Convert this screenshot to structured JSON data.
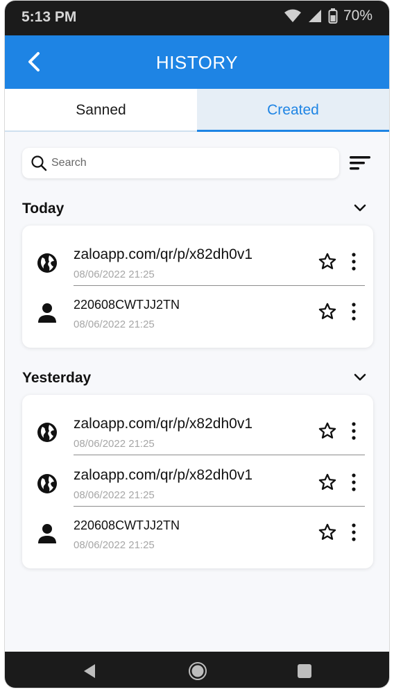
{
  "status": {
    "time": "5:13 PM",
    "battery": "70%"
  },
  "header": {
    "title": "HISTORY"
  },
  "tabs": [
    {
      "label": "Sanned"
    },
    {
      "label": "Created"
    }
  ],
  "search": {
    "placeholder": "Search"
  },
  "sections": [
    {
      "title": "Today",
      "items": [
        {
          "type": "globe-icon",
          "text": "zaloapp.com/qr/p/x82dh0v1",
          "date": "08/06/2022   21:25"
        },
        {
          "type": "person-icon",
          "text": "220608CWTJJ2TN",
          "date": "08/06/2022   21:25"
        }
      ]
    },
    {
      "title": "Yesterday",
      "items": [
        {
          "type": "globe-icon",
          "text": "zaloapp.com/qr/p/x82dh0v1",
          "date": "08/06/2022   21:25"
        },
        {
          "type": "globe-icon",
          "text": "zaloapp.com/qr/p/x82dh0v1",
          "date": "08/06/2022   21:25"
        },
        {
          "type": "person-icon",
          "text": "220608CWTJJ2TN",
          "date": "08/06/2022   21:25"
        }
      ]
    }
  ],
  "colors": {
    "primary": "#1e84e4",
    "bar": "#1b1b1b",
    "muted": "#a6a6a6"
  }
}
